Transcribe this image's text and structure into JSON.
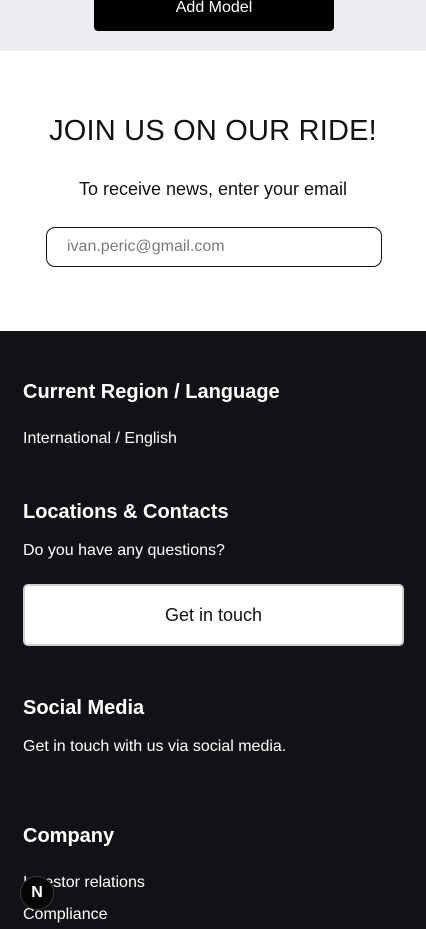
{
  "top": {
    "add_model_label": "Add Model"
  },
  "newsletter": {
    "title": "JOIN US ON OUR RIDE!",
    "subtitle": "To receive news, enter your email",
    "email_placeholder": "ivan.peric@gmail.com"
  },
  "footer": {
    "region": {
      "heading": "Current Region / Language",
      "value": "International / English"
    },
    "contacts": {
      "heading": "Locations & Contacts",
      "question": "Do you have any questions?",
      "button_label": "Get in touch"
    },
    "social": {
      "heading": "Social Media",
      "text": "Get in touch with us via social media."
    },
    "company": {
      "heading": "Company",
      "links": [
        "Investor relations",
        "Compliance"
      ]
    }
  },
  "fab": {
    "label": "N",
    "icon": "nextjs-logo-icon"
  },
  "colors": {
    "footer_bg": "#121216",
    "top_band_bg": "#eceef2",
    "button_dark": "#000000"
  }
}
